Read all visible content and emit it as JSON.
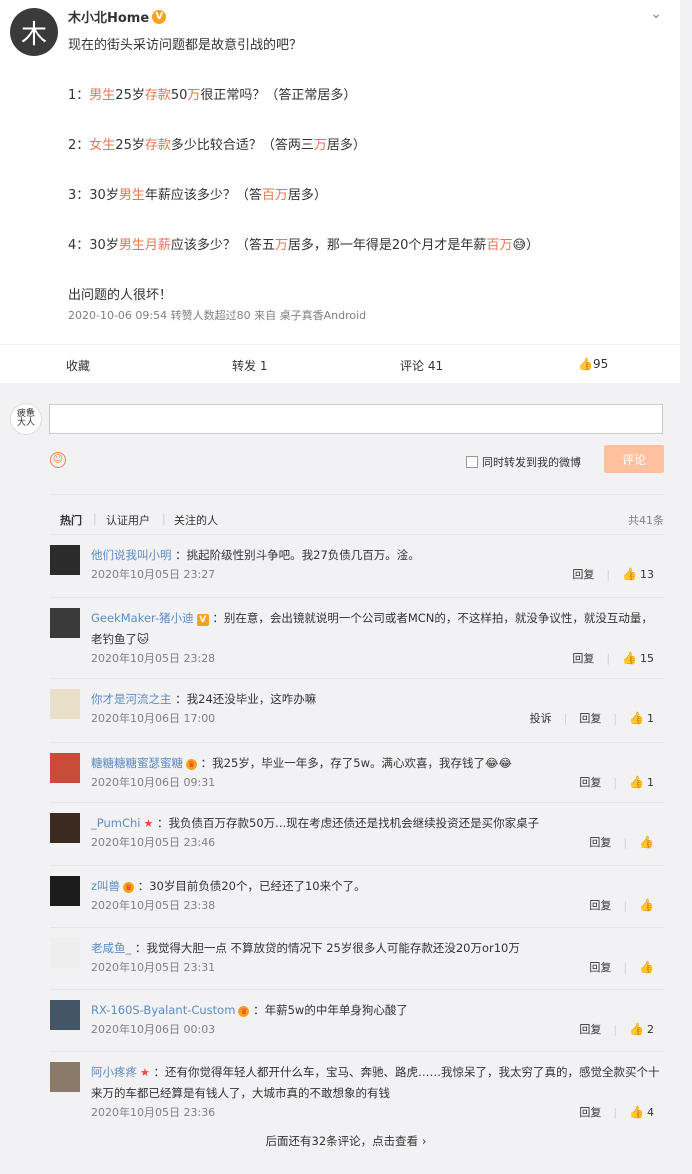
{
  "post": {
    "author": "木小北Home",
    "author_avatar_char": "木",
    "lines": [
      [
        {
          "t": "现在的街头采访问题都是故意引战的吧？",
          "r": false
        }
      ],
      [
        {
          "t": "1：",
          "r": false
        },
        {
          "t": "男生",
          "r": true
        },
        {
          "t": "25岁",
          "r": false
        },
        {
          "t": "存款",
          "r": true
        },
        {
          "t": "50",
          "r": false
        },
        {
          "t": "万",
          "r": true
        },
        {
          "t": "很正常吗？（答正常居多）",
          "r": false
        }
      ],
      [
        {
          "t": "2：",
          "r": false
        },
        {
          "t": "女生",
          "r": true
        },
        {
          "t": "25岁",
          "r": false
        },
        {
          "t": "存款",
          "r": true
        },
        {
          "t": "多少比较合适？（答两三",
          "r": false
        },
        {
          "t": "万",
          "r": true
        },
        {
          "t": "居多）",
          "r": false
        }
      ],
      [
        {
          "t": "3：30岁",
          "r": false
        },
        {
          "t": "男生",
          "r": true
        },
        {
          "t": "年薪应该多少？（答",
          "r": false
        },
        {
          "t": "百万",
          "r": true
        },
        {
          "t": "居多）",
          "r": false
        }
      ],
      [
        {
          "t": "4：30岁",
          "r": false
        },
        {
          "t": "男生",
          "r": true
        },
        {
          "t": "月薪",
          "r": true
        },
        {
          "t": "应该多少？（答五",
          "r": false
        },
        {
          "t": "万",
          "r": true
        },
        {
          "t": "居多，那一年得是20个月才是年薪",
          "r": false
        },
        {
          "t": "百万",
          "r": true
        },
        {
          "t": "😅）",
          "r": false
        }
      ],
      [
        {
          "t": "出问题的人很坏！",
          "r": false
        }
      ]
    ],
    "meta": "2020-10-06 09:54  转赞人数超过80  来自 桌子真香Android",
    "actions": {
      "favorite": "收藏",
      "repost": "转发 1",
      "comment": "评论 41",
      "like": "95"
    }
  },
  "composer": {
    "my_avatar_text": "疲惫\n大人",
    "forward_label": "同时转发到我的微博",
    "submit_label": "评论"
  },
  "tabs": {
    "hot": "热门",
    "verified": "认证用户",
    "following": "关注的人",
    "total": "共41条"
  },
  "comments": [
    {
      "user": "他们说我叫小明",
      "badge": "",
      "text": "：挑起阶级性别斗争吧。我27负债几百万。淦。",
      "time": "2020年10月05日 23:27",
      "reply": "回复",
      "likes": "13",
      "report": ""
    },
    {
      "user": "GeekMaker-猪小迪",
      "badge": "v",
      "text": "：别在意，会出镜就说明一个公司或者MCN的，不这样拍，就没争议性，就没互动量，老钓鱼了🐱",
      "time": "2020年10月05日 23:28",
      "reply": "回复",
      "likes": "15",
      "report": ""
    },
    {
      "user": "你才是河流之主",
      "badge": "",
      "text": "：我24还没毕业，这咋办嘛",
      "time": "2020年10月06日 17:00",
      "reply": "回复",
      "likes": "1",
      "report": "投诉"
    },
    {
      "user": "糖糖糖糖蜜瑟蜜糖",
      "badge": "crown",
      "text": "：我25岁，毕业一年多，存了5w。满心欢喜，我存钱了😂😂",
      "time": "2020年10月06日 09:31",
      "reply": "回复",
      "likes": "1",
      "report": ""
    },
    {
      "user": "_PumChi",
      "badge": "star",
      "text": "：我负债百万存款50万...现在考虑还债还是找机会继续投资还是买你家桌子",
      "time": "2020年10月05日 23:46",
      "reply": "回复",
      "likes": "",
      "report": ""
    },
    {
      "user": "z叫兽",
      "badge": "crown",
      "text": "：30岁目前负债20个，已经还了10来个了。",
      "time": "2020年10月05日 23:38",
      "reply": "回复",
      "likes": "",
      "report": ""
    },
    {
      "user": "老咸鱼_",
      "badge": "",
      "text": "：我觉得大胆一点 不算放贷的情况下 25岁很多人可能存款还没20万or10万",
      "time": "2020年10月05日 23:31",
      "reply": "回复",
      "likes": "",
      "report": ""
    },
    {
      "user": "RX-160S-Byalant-Custom",
      "badge": "crown",
      "text": "：年薪5w的中年单身狗心酸了",
      "time": "2020年10月06日 00:03",
      "reply": "回复",
      "likes": "2",
      "report": ""
    },
    {
      "user": "阿小疼疼",
      "badge": "star",
      "text": "：还有你觉得年轻人都开什么车，宝马、奔驰、路虎……我惊呆了，我太穷了真的，感觉全款买个十来万的车都已经算是有钱人了，大城市真的不敢想象的有钱",
      "time": "2020年10月05日 23:36",
      "reply": "回复",
      "likes": "4",
      "report": ""
    }
  ],
  "more_text": "后面还有32条评论，点击查看 ›",
  "colors": {
    "red": "#eb7350",
    "link": "#5d8cbf",
    "accent": "#fa7d3c"
  }
}
